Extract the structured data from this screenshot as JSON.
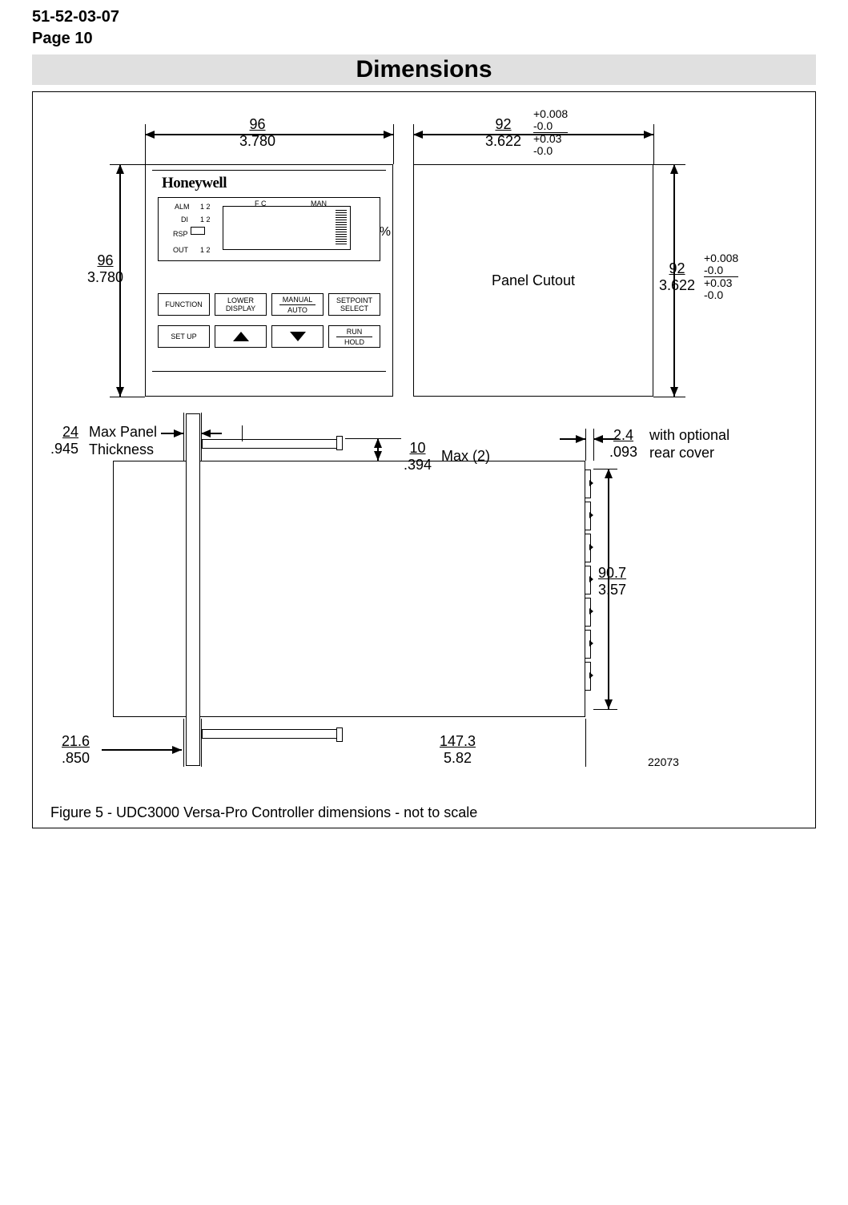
{
  "doc_number": "51-52-03-07",
  "page_label": "Page 10",
  "section_title": "Dimensions",
  "figure_caption": "Figure 5 - UDC3000 Versa-Pro Controller dimensions - not to scale",
  "drawing_number": "22073",
  "brand": "Honeywell",
  "panel_cutout_label": "Panel Cutout",
  "labels": {
    "max_panel": "Max Panel",
    "thickness": "Thickness",
    "max2": "Max (2)",
    "with_rear": "with optional",
    "rear_cover": "rear cover"
  },
  "dimensions": {
    "front_w": {
      "mm": "96",
      "in": "3.780"
    },
    "front_h": {
      "mm": "96",
      "in": "3.780"
    },
    "cutout_w": {
      "mm": "92",
      "in": "3.622"
    },
    "cutout_h": {
      "mm": "92",
      "in": "3.622"
    },
    "tol_w_top": "+0.008",
    "tol_w_top2": "-0.0",
    "tol_w_bot": "+0.03",
    "tol_w_bot2": "-0.0",
    "tol_h_top": "+0.008",
    "tol_h_top2": "-0.0",
    "tol_h_bot": "+0.03",
    "tol_h_bot2": "-0.0",
    "panel_thk": {
      "mm": "24",
      "in": ".945"
    },
    "bracket_proj": {
      "mm": "10",
      "in": ".394"
    },
    "rear_gap": {
      "mm": "2.4",
      "in": ".093"
    },
    "rear_h": {
      "mm": "90.7",
      "in": "3.57"
    },
    "bezel_proj": {
      "mm": "21.6",
      "in": ".850"
    },
    "depth": {
      "mm": "147.3",
      "in": "5.82"
    }
  },
  "device": {
    "status": {
      "alm": "ALM",
      "di": "DI",
      "rsp": "RSP",
      "out": "OUT",
      "one_two_a": "1 2",
      "one_two_b": "1 2",
      "one_two_c": "1 2",
      "fc": "F C",
      "man": "MAN",
      "pct": "%"
    },
    "buttons": {
      "function": "FUNCTION",
      "lower_display_l1": "LOWER",
      "lower_display_l2": "DISPLAY",
      "manual": "MANUAL",
      "auto": "AUTO",
      "setpoint_l1": "SETPOINT",
      "setpoint_l2": "SELECT",
      "setup": "SET UP",
      "run": "RUN",
      "hold": "HOLD"
    }
  }
}
